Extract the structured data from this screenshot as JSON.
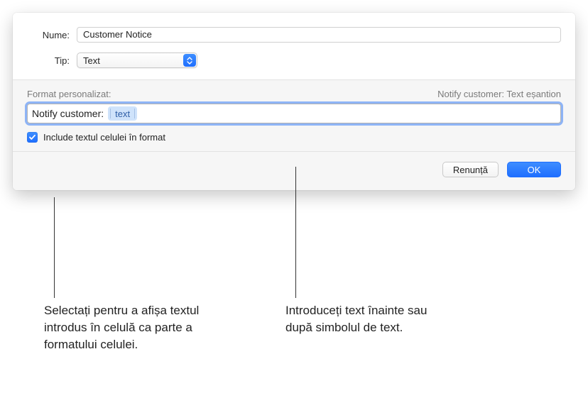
{
  "form": {
    "name_label": "Nume:",
    "name_value": "Customer Notice",
    "type_label": "Tip:",
    "type_value": "Text"
  },
  "format": {
    "section_label": "Format personalizat:",
    "sample_label": "Notify customer: Text eșantion",
    "prefix_text": "Notify customer:",
    "token_label": "text"
  },
  "checkbox": {
    "checked": true,
    "label": "Include textul celulei în format"
  },
  "buttons": {
    "cancel": "Renunță",
    "ok": "OK"
  },
  "callouts": {
    "left": "Selectați pentru a afișa textul introdus în celulă ca parte a formatului celulei.",
    "right": "Introduceți text înainte sau după simbolul de text."
  }
}
